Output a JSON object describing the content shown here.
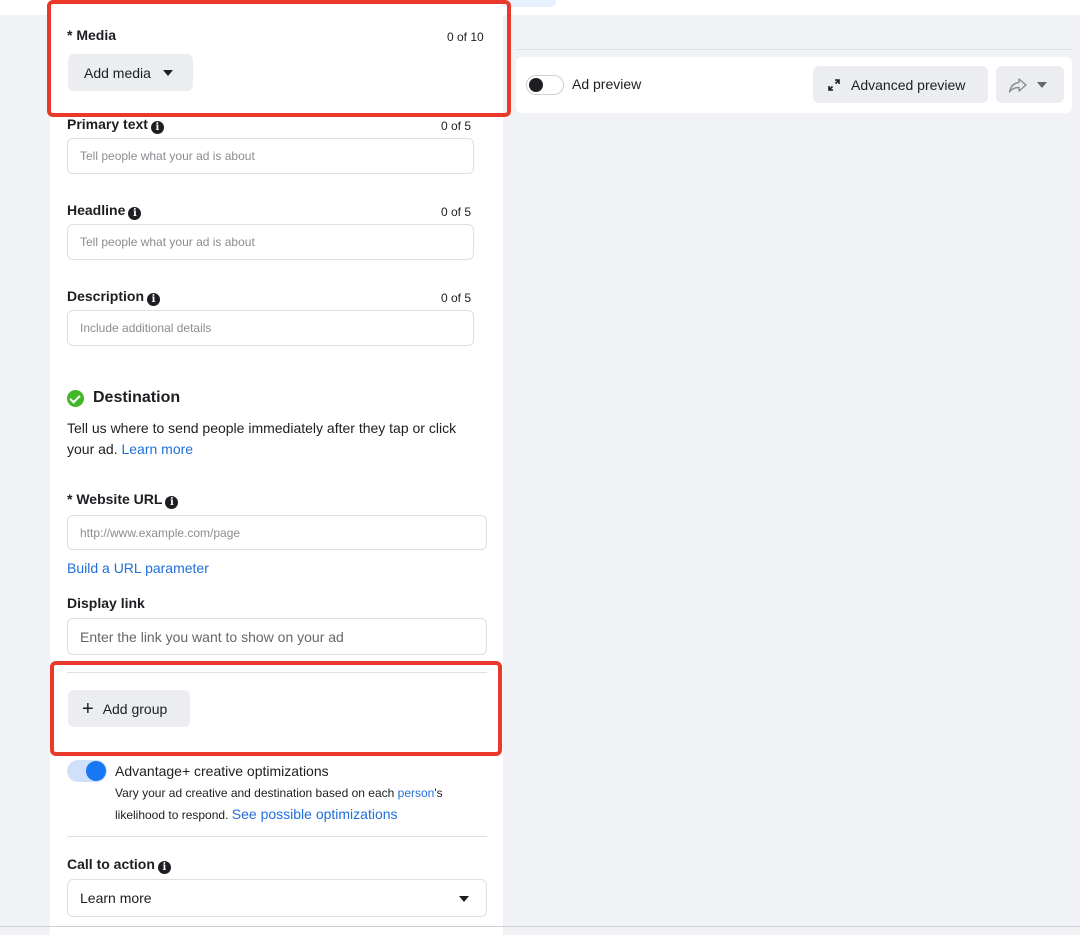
{
  "media": {
    "label": "* Media",
    "counter": "0 of 10",
    "add_button": "Add media"
  },
  "primary_text": {
    "label": "Primary text",
    "counter": "0 of 5",
    "placeholder": "Tell people what your ad is about"
  },
  "headline": {
    "label": "Headline",
    "counter": "0 of 5",
    "placeholder": "Tell people what your ad is about"
  },
  "description": {
    "label": "Description",
    "counter": "0 of 5",
    "placeholder": "Include additional details"
  },
  "destination": {
    "title": "Destination",
    "text": "Tell us where to send people immediately after they tap or click your ad.",
    "learn_more": "Learn more"
  },
  "website_url": {
    "label": "* Website URL",
    "placeholder": "http://www.example.com/page",
    "build_param": "Build a URL parameter"
  },
  "display_link": {
    "label": "Display link",
    "placeholder": "Enter the link you want to show on your ad"
  },
  "add_group": {
    "label": "Add group"
  },
  "advantage": {
    "title": "Advantage+ creative optimizations",
    "desc_before": "Vary your ad creative and destination based on each",
    "person_link": "person",
    "desc_mid": "'s likelihood to respond.",
    "see_link": "See possible optimizations",
    "enabled": true
  },
  "cta": {
    "label": "Call to action",
    "selected": "Learn more"
  },
  "preview": {
    "toggle_label": "Ad preview",
    "advanced_button": "Advanced preview",
    "enabled": false
  },
  "icons": {
    "info": "info-icon",
    "expand": "expand-icon",
    "share": "share-icon",
    "plus": "plus-icon",
    "check": "check-circle-icon",
    "caret": "caret-down-icon"
  },
  "colors": {
    "highlight": "#e8392b",
    "link": "#216fdb",
    "toggle_on": "#1877f2",
    "check": "#42b72a"
  }
}
